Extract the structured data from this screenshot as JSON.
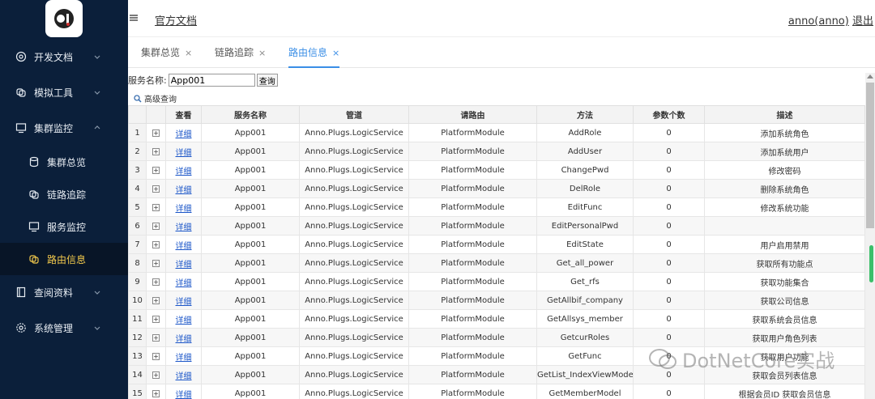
{
  "sidebar": {
    "items": [
      {
        "label": "开发文档",
        "icon": "globe-icon"
      },
      {
        "label": "模拟工具",
        "icon": "tool-icon"
      },
      {
        "label": "集群监控",
        "icon": "monitor-icon"
      },
      {
        "label": "查阅资料",
        "icon": "book-icon"
      },
      {
        "label": "系统管理",
        "icon": "gear-icon"
      }
    ],
    "sub_items": [
      {
        "label": "集群总览",
        "icon": "database-icon"
      },
      {
        "label": "链路追踪",
        "icon": "link-icon"
      },
      {
        "label": "服务监控",
        "icon": "monitor-icon"
      },
      {
        "label": "路由信息",
        "icon": "route-icon"
      }
    ]
  },
  "header": {
    "doc_link": "官方文档",
    "user": "anno(anno)",
    "logout": "退出"
  },
  "tabs": [
    {
      "label": "集群总览",
      "close": "×"
    },
    {
      "label": "链路追踪",
      "close": "×"
    },
    {
      "label": "路由信息",
      "close": "×"
    }
  ],
  "search": {
    "label": "服务名称:",
    "value": "App001",
    "button": "查询",
    "advanced": "高级查询"
  },
  "table": {
    "headers": [
      "查看",
      "服务名称",
      "管道",
      "请路由",
      "方法",
      "参数个数",
      "描述"
    ],
    "detail_link": "详细",
    "expander": "+",
    "rows": [
      {
        "n": "1",
        "service": "App001",
        "pipe": "Anno.Plugs.LogicService",
        "route": "PlatformModule",
        "method": "AddRole",
        "params": "0",
        "desc": "添加系统角色"
      },
      {
        "n": "2",
        "service": "App001",
        "pipe": "Anno.Plugs.LogicService",
        "route": "PlatformModule",
        "method": "AddUser",
        "params": "0",
        "desc": "添加系统用户"
      },
      {
        "n": "3",
        "service": "App001",
        "pipe": "Anno.Plugs.LogicService",
        "route": "PlatformModule",
        "method": "ChangePwd",
        "params": "0",
        "desc": "修改密码"
      },
      {
        "n": "4",
        "service": "App001",
        "pipe": "Anno.Plugs.LogicService",
        "route": "PlatformModule",
        "method": "DelRole",
        "params": "0",
        "desc": "删除系统角色"
      },
      {
        "n": "5",
        "service": "App001",
        "pipe": "Anno.Plugs.LogicService",
        "route": "PlatformModule",
        "method": "EditFunc",
        "params": "0",
        "desc": "修改系统功能"
      },
      {
        "n": "6",
        "service": "App001",
        "pipe": "Anno.Plugs.LogicService",
        "route": "PlatformModule",
        "method": "EditPersonalPwd",
        "params": "0",
        "desc": ""
      },
      {
        "n": "7",
        "service": "App001",
        "pipe": "Anno.Plugs.LogicService",
        "route": "PlatformModule",
        "method": "EditState",
        "params": "0",
        "desc": "用户启用禁用"
      },
      {
        "n": "8",
        "service": "App001",
        "pipe": "Anno.Plugs.LogicService",
        "route": "PlatformModule",
        "method": "Get_all_power",
        "params": "0",
        "desc": "获取所有功能点"
      },
      {
        "n": "9",
        "service": "App001",
        "pipe": "Anno.Plugs.LogicService",
        "route": "PlatformModule",
        "method": "Get_rfs",
        "params": "0",
        "desc": "获取功能集合"
      },
      {
        "n": "10",
        "service": "App001",
        "pipe": "Anno.Plugs.LogicService",
        "route": "PlatformModule",
        "method": "GetAllbif_company",
        "params": "0",
        "desc": "获取公司信息"
      },
      {
        "n": "11",
        "service": "App001",
        "pipe": "Anno.Plugs.LogicService",
        "route": "PlatformModule",
        "method": "GetAllsys_member",
        "params": "0",
        "desc": "获取系统会员信息"
      },
      {
        "n": "12",
        "service": "App001",
        "pipe": "Anno.Plugs.LogicService",
        "route": "PlatformModule",
        "method": "GetcurRoles",
        "params": "0",
        "desc": "获取用户角色列表"
      },
      {
        "n": "13",
        "service": "App001",
        "pipe": "Anno.Plugs.LogicService",
        "route": "PlatformModule",
        "method": "GetFunc",
        "params": "0",
        "desc": "获取用户功能"
      },
      {
        "n": "14",
        "service": "App001",
        "pipe": "Anno.Plugs.LogicService",
        "route": "PlatformModule",
        "method": "GetList_IndexViewModel",
        "params": "0",
        "desc": "获取会员列表信息"
      },
      {
        "n": "15",
        "service": "App001",
        "pipe": "Anno.Plugs.LogicService",
        "route": "PlatformModule",
        "method": "GetMemberModel",
        "params": "0",
        "desc": "根据会员ID 获取会员信息"
      }
    ]
  },
  "watermark": "DotNetCore实战",
  "colors": {
    "sidebar_bg": "#0b1f3a",
    "active_text": "#f2c94c",
    "tab_active": "#3a8ee6",
    "link": "#1a55c8"
  }
}
